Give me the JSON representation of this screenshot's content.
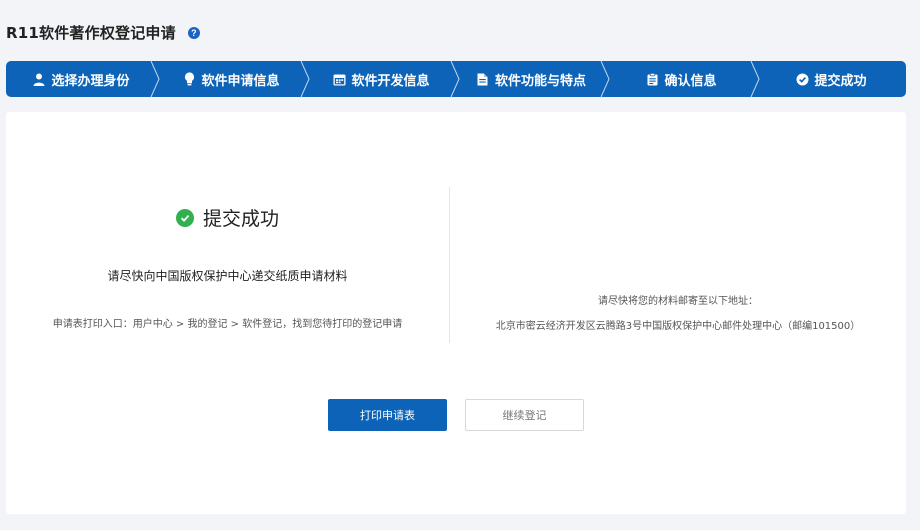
{
  "header": {
    "title": "R11软件著作权登记申请",
    "help_icon": "question-circle-icon",
    "help_glyph": "?"
  },
  "colors": {
    "primary": "#0c63b8",
    "success": "#30b04f",
    "background": "#f2f4f7"
  },
  "steps": [
    {
      "label": "选择办理身份",
      "icon": "user-icon"
    },
    {
      "label": "软件申请信息",
      "icon": "lightbulb-icon"
    },
    {
      "label": "软件开发信息",
      "icon": "calendar-icon"
    },
    {
      "label": "软件功能与特点",
      "icon": "document-icon"
    },
    {
      "label": "确认信息",
      "icon": "clipboard-icon"
    },
    {
      "label": "提交成功",
      "icon": "check-circle-icon"
    }
  ],
  "result": {
    "title": "提交成功",
    "instruction": "请尽快向中国版权保护中心递交纸质申请材料",
    "print_entry": "申请表打印入口：用户中心 > 我的登记 > 软件登记，找到您待打印的登记申请",
    "mail_intro": "请尽快将您的材料邮寄至以下地址：",
    "mail_address": "北京市密云经济开发区云腾路3号中国版权保护中心邮件处理中心（邮编101500）"
  },
  "actions": {
    "print_label": "打印申请表",
    "continue_label": "继续登记"
  }
}
